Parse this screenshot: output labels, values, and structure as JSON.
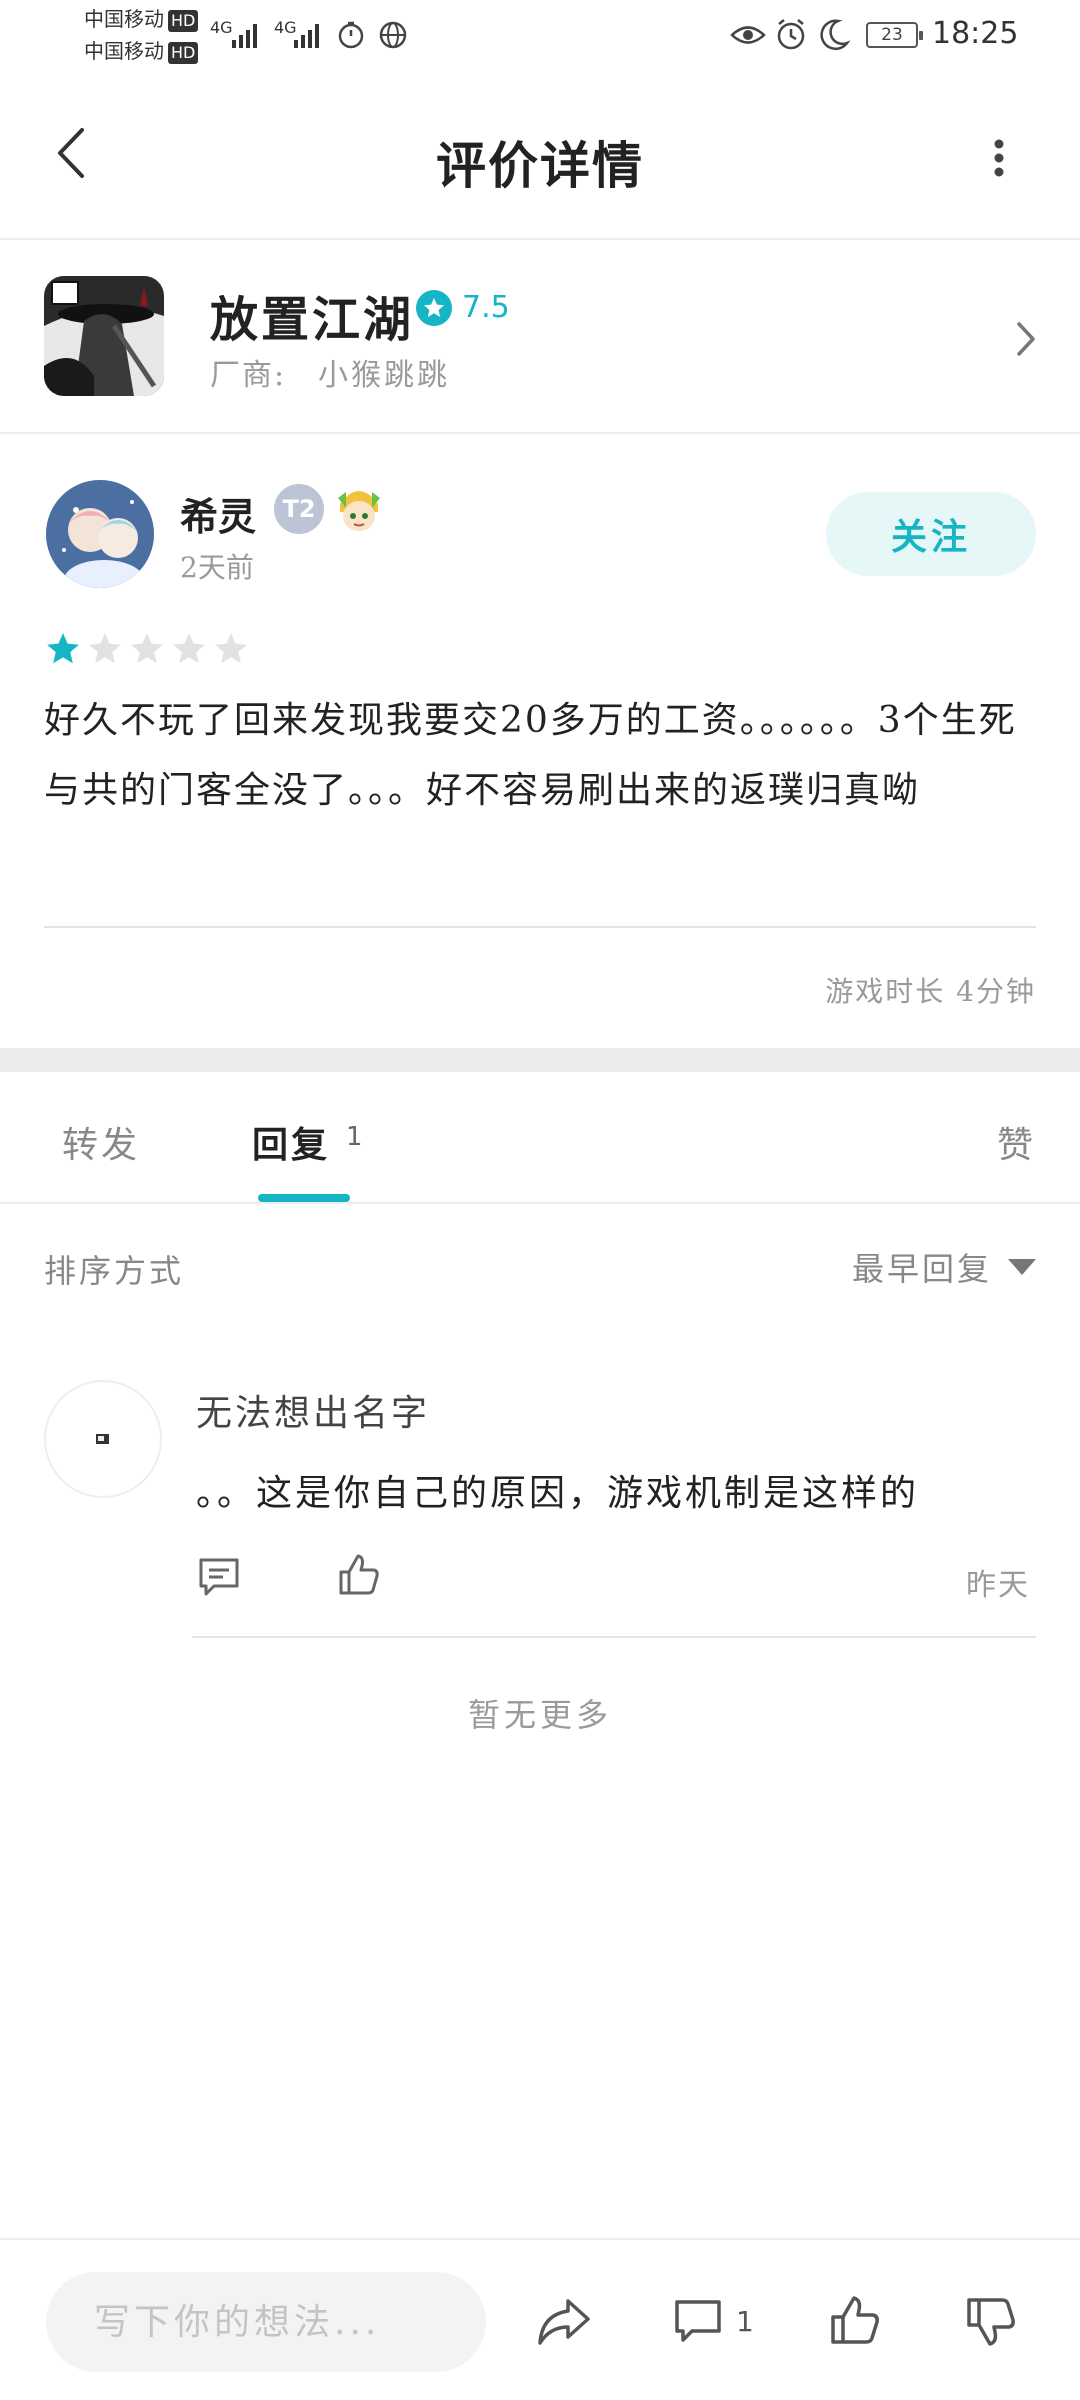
{
  "status_bar": {
    "carrier_1": "中国移动",
    "carrier_2": "中国移动",
    "hd_badge": "HD",
    "network_1": "4G",
    "network_2": "4G",
    "battery": "23",
    "time": "18:25",
    "icons": [
      "eye-icon",
      "alarm-icon",
      "moon-icon"
    ]
  },
  "header": {
    "title": "评价详情",
    "back_icon": "chevron-left-icon",
    "more_icon": "more-vertical-icon"
  },
  "game": {
    "name": "放置江湖",
    "score": "7.5",
    "maker_label": "厂商:",
    "maker": "小猴跳跳"
  },
  "review": {
    "username": "希灵",
    "level_badge": "T2",
    "time_ago": "2天前",
    "follow_label": "关注",
    "rating": 1,
    "rating_max": 5,
    "text": "好久不玩了回来发现我要交20多万的工资。。。。。。3个生死与共的门客全没了。。。好不容易刷出来的返璞归真呦",
    "playtime": "游戏时长 4分钟"
  },
  "tabs": {
    "forward": "转发",
    "reply": "回复",
    "reply_count": "1",
    "like": "赞"
  },
  "sort": {
    "label": "排序方式",
    "value": "最早回复"
  },
  "comments": [
    {
      "name": "无法想出名字",
      "text": "。。这是你自己的原因，游戏机制是这样的",
      "time": "昨天"
    }
  ],
  "no_more": "暂无更多",
  "bottom_bar": {
    "placeholder": "写下你的想法...",
    "comment_count": "1"
  },
  "colors": {
    "accent": "#15b5c6",
    "follow_bg": "#e6f7f8",
    "muted_text": "#9a9a9a",
    "divider": "#eeeeee"
  }
}
